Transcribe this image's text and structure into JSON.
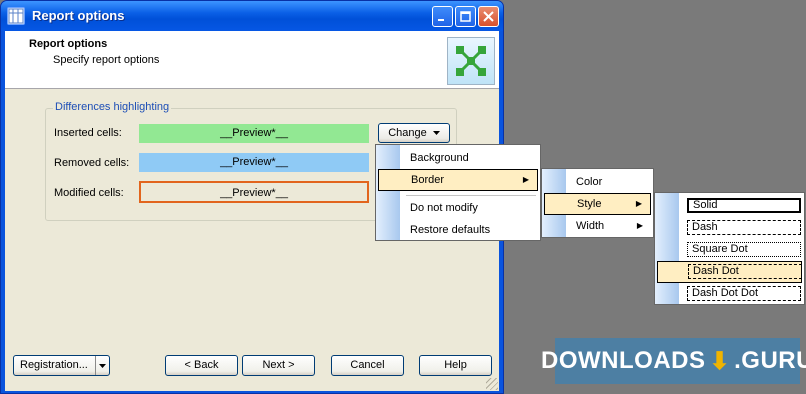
{
  "window": {
    "title": "Report options"
  },
  "header": {
    "title": "Report options",
    "subtitle": "Specify report options"
  },
  "group": {
    "legend": "Differences highlighting"
  },
  "rows": [
    {
      "label": "Inserted cells:",
      "preview": "__Preview*__"
    },
    {
      "label": "Removed cells:",
      "preview": "__Preview*__"
    },
    {
      "label": "Modified cells:",
      "preview": "__Preview*__"
    }
  ],
  "change_button": {
    "label": "Change"
  },
  "menu_main": {
    "items": [
      "Background",
      "Border",
      "Do not modify",
      "Restore defaults"
    ],
    "selected": "Border"
  },
  "menu_border": {
    "items": [
      "Color",
      "Style",
      "Width"
    ],
    "selected": "Style"
  },
  "menu_style": {
    "items": [
      "Solid",
      "Dash",
      "Square Dot",
      "Dash Dot",
      "Dash Dot Dot"
    ],
    "selected": "Dash Dot"
  },
  "footer": {
    "registration": "Registration...",
    "back": "< Back",
    "next": "Next >",
    "cancel": "Cancel",
    "help": "Help"
  },
  "watermark": {
    "text_left": "DOWNLOADS",
    "text_right": ".GURU"
  },
  "colors": {
    "inserted": "#92e893",
    "removed": "#8fcaf5",
    "modified_border": "#e2651d",
    "menu_highlight": "#ffeec2"
  }
}
